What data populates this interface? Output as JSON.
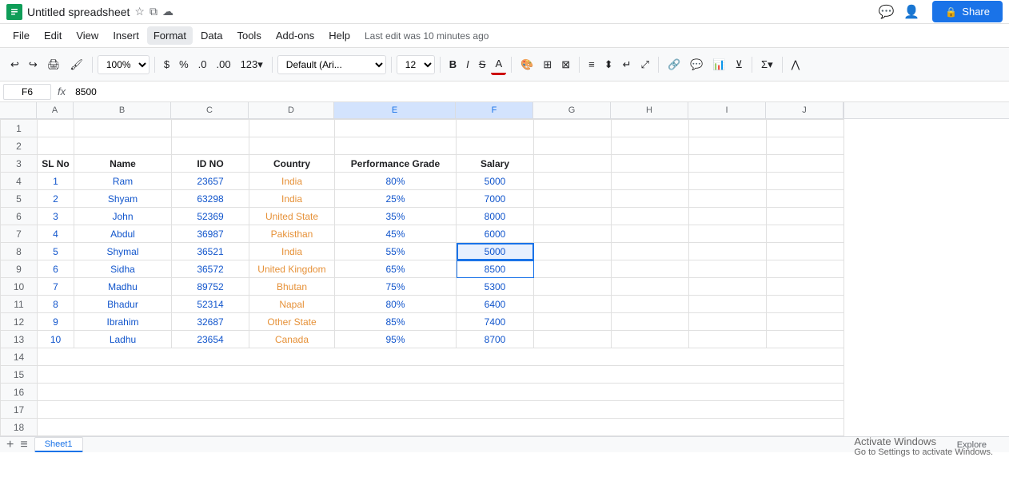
{
  "app": {
    "title": "Untitled spreadsheet",
    "last_edit": "Last edit was 10 minutes ago"
  },
  "header": {
    "share_label": "Share",
    "zoom": "100%",
    "font": "Default (Ari...",
    "font_size": "12"
  },
  "menu": {
    "items": [
      "File",
      "Edit",
      "View",
      "Insert",
      "Format",
      "Data",
      "Tools",
      "Add-ons",
      "Help"
    ]
  },
  "formula_bar": {
    "cell_ref": "F6",
    "fx": "fx",
    "value": "8500"
  },
  "columns": {
    "headers": [
      "",
      "A",
      "B",
      "C",
      "D",
      "E",
      "F",
      "G",
      "H",
      "I",
      "J"
    ]
  },
  "spreadsheet": {
    "header_row": {
      "sl_no": "SL No",
      "name": "Name",
      "id_no": "ID NO",
      "country": "Country",
      "performance_grade": "Performance Grade",
      "salary": "Salary"
    },
    "rows": [
      {
        "sl": "1",
        "name": "Ram",
        "id": "23657",
        "country": "India",
        "grade": "80%",
        "salary": "5000"
      },
      {
        "sl": "2",
        "name": "Shyam",
        "id": "63298",
        "country": "India",
        "grade": "25%",
        "salary": "7000"
      },
      {
        "sl": "3",
        "name": "John",
        "id": "52369",
        "country": "United State",
        "grade": "35%",
        "salary": "8000"
      },
      {
        "sl": "4",
        "name": "Abdul",
        "id": "36987",
        "country": "Pakisthan",
        "grade": "45%",
        "salary": "6000"
      },
      {
        "sl": "5",
        "name": "Shymal",
        "id": "36521",
        "country": "India",
        "grade": "55%",
        "salary": "5000"
      },
      {
        "sl": "6",
        "name": "Sidha",
        "id": "36572",
        "country": "United Kingdom",
        "grade": "65%",
        "salary": "8500"
      },
      {
        "sl": "7",
        "name": "Madhu",
        "id": "89752",
        "country": "Bhutan",
        "grade": "75%",
        "salary": "5300"
      },
      {
        "sl": "8",
        "name": "Bhadur",
        "id": "52314",
        "country": "Napal",
        "grade": "80%",
        "salary": "6400"
      },
      {
        "sl": "9",
        "name": "Ibrahim",
        "id": "32687",
        "country": "Other State",
        "grade": "85%",
        "salary": "7400"
      },
      {
        "sl": "10",
        "name": "Ladhu",
        "id": "23654",
        "country": "Canada",
        "grade": "95%",
        "salary": "8700"
      }
    ]
  },
  "sheet_tab": "Sheet1",
  "watermark": {
    "line1": "Activate Windows",
    "line2": "Go to Settings to activate Windows."
  }
}
